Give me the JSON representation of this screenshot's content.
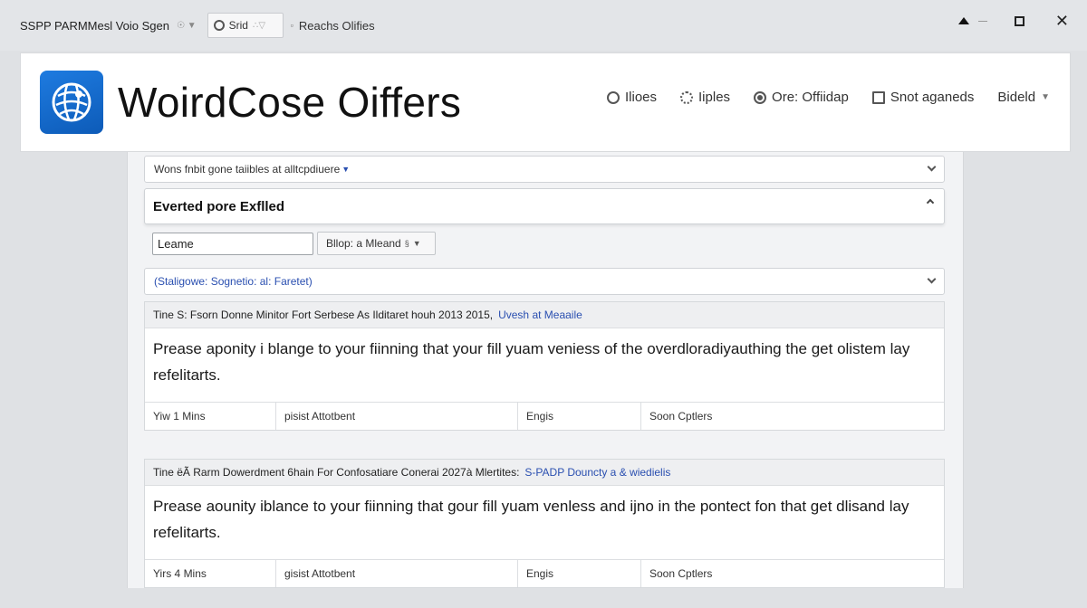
{
  "titlebar": {
    "title": "SSPP PARMMesl Voio Sgen",
    "title_dropdown": "☉ ▼",
    "tab_label": "Srid",
    "tab_extra": "∴▽",
    "reach_label": "Reachs Olifies"
  },
  "header": {
    "brand": "WoirdCose Oiffers",
    "nav": [
      {
        "label": "Ilioes",
        "icon": "gear-icon"
      },
      {
        "label": "Iiples",
        "icon": "cog-icon"
      },
      {
        "label": "Ore: Offiidap",
        "icon": "target-icon"
      },
      {
        "label": "Snot aganeds",
        "icon": "box-icon"
      },
      {
        "label": "Bideld",
        "icon": "chevron-down-icon"
      }
    ]
  },
  "panel": {
    "top_select": {
      "label": "Wons fnbit gone taiibles at alltcpdiuere",
      "caret": "▼"
    },
    "section_title": "Everted pore Exflled",
    "name_input_value": "Leame",
    "filter_select": {
      "label": "Bllop: a Mleand",
      "suffix": "§"
    },
    "status_select": {
      "label": "(Staligowe: Sognetio: al: Faretet)"
    },
    "cards": [
      {
        "meta": "Tine S: Fsorn Donne Minitor Fort Serbese As Ilditaret houh 2013 2015,",
        "meta_link": "Uvesh at Meaaile",
        "body": "Prease aponity i blange to your fiinning that your fill yuam veniess of the overdloradiyauthing the get olistem lay refelitarts.",
        "foot": [
          "Yiw 1 Mins",
          "pisist Attotbent",
          "Engis",
          "Soon Cptlers"
        ]
      },
      {
        "meta": "Tine ëÃ Rarm Dowerdment 6hain For Confosatiare Conerai 2027à Mlertites:",
        "meta_link": "S-PADP Douncty a & wiedielis",
        "body": "Prease aounity iblance to your fiinning that gour fill yuam venless and ijno in the pontect fon that get dlisand lay refelitarts.",
        "foot": [
          "Yirs 4 Mins",
          "gisist Attotbent",
          "Engis",
          "Soon Cptlers"
        ]
      }
    ]
  }
}
